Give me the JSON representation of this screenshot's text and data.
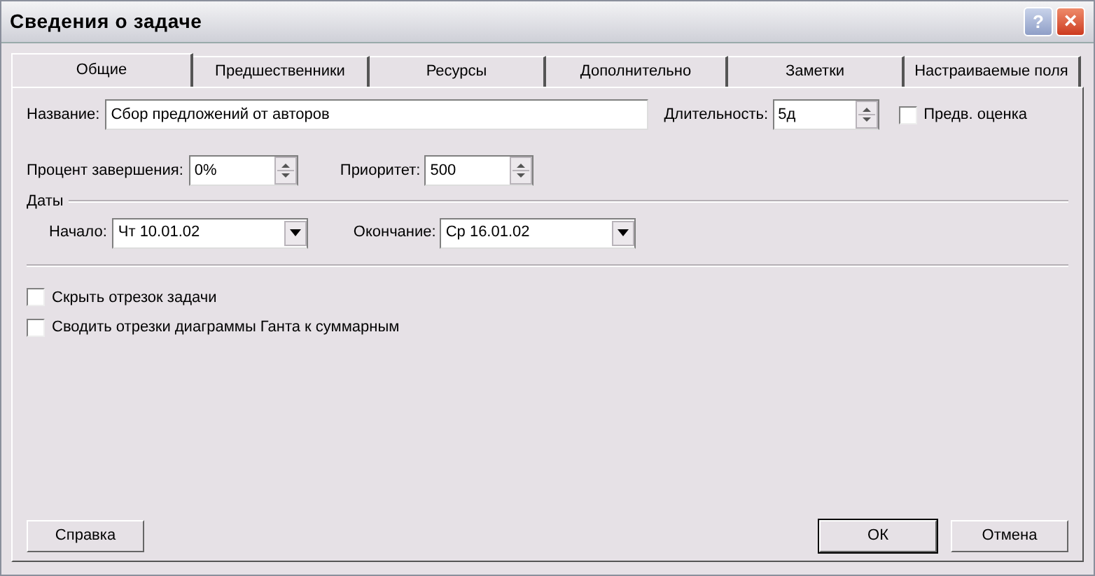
{
  "window": {
    "title": "Сведения о задаче",
    "help": "?",
    "close": "×"
  },
  "tabs": [
    {
      "label": "Общие",
      "selected": true
    },
    {
      "label": "Предшественники",
      "selected": false
    },
    {
      "label": "Ресурсы",
      "selected": false
    },
    {
      "label": "Дополнительно",
      "selected": false
    },
    {
      "label": "Заметки",
      "selected": false
    },
    {
      "label": "Настраиваемые поля",
      "selected": false
    }
  ],
  "name": {
    "label": "Название:",
    "value": "Сбор предложений от авторов"
  },
  "duration": {
    "label": "Длительность:",
    "value": "5д"
  },
  "estimate": {
    "label": "Предв. оценка",
    "checked": false
  },
  "percent": {
    "label": "Процент завершения:",
    "value": "0%"
  },
  "priority": {
    "label": "Приоритет:",
    "value": "500"
  },
  "dates": {
    "title": "Даты",
    "start": {
      "label": "Начало:",
      "value": "Чт 10.01.02"
    },
    "finish": {
      "label": "Окончание:",
      "value": "Ср 16.01.02"
    }
  },
  "options": [
    {
      "label": "Скрыть отрезок задачи",
      "checked": false
    },
    {
      "label": "Сводить отрезки диаграммы Ганта к суммарным",
      "checked": false
    }
  ],
  "buttons": {
    "help": "Справка",
    "ok": "ОК",
    "cancel": "Отмена"
  }
}
